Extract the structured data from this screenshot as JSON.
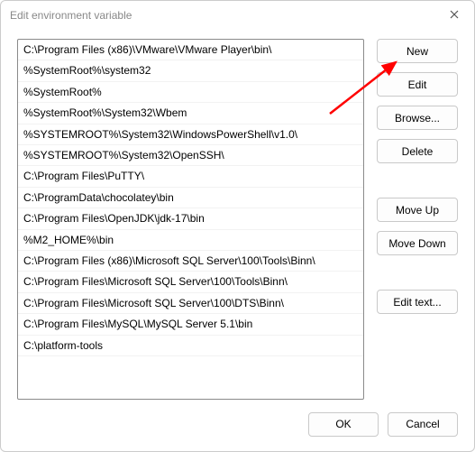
{
  "window": {
    "title": "Edit environment variable"
  },
  "list": {
    "items": [
      "C:\\Program Files (x86)\\VMware\\VMware Player\\bin\\",
      "%SystemRoot%\\system32",
      "%SystemRoot%",
      "%SystemRoot%\\System32\\Wbem",
      "%SYSTEMROOT%\\System32\\WindowsPowerShell\\v1.0\\",
      "%SYSTEMROOT%\\System32\\OpenSSH\\",
      "C:\\Program Files\\PuTTY\\",
      "C:\\ProgramData\\chocolatey\\bin",
      "C:\\Program Files\\OpenJDK\\jdk-17\\bin",
      "%M2_HOME%\\bin",
      "C:\\Program Files (x86)\\Microsoft SQL Server\\100\\Tools\\Binn\\",
      "C:\\Program Files\\Microsoft SQL Server\\100\\Tools\\Binn\\",
      "C:\\Program Files\\Microsoft SQL Server\\100\\DTS\\Binn\\",
      "C:\\Program Files\\MySQL\\MySQL Server 5.1\\bin",
      "C:\\platform-tools"
    ]
  },
  "buttons": {
    "new": "New",
    "edit": "Edit",
    "browse": "Browse...",
    "delete": "Delete",
    "moveup": "Move Up",
    "movedown": "Move Down",
    "edittext": "Edit text...",
    "ok": "OK",
    "cancel": "Cancel"
  },
  "annotation": {
    "arrow_color": "#ff0000",
    "points_to": "new-button"
  }
}
